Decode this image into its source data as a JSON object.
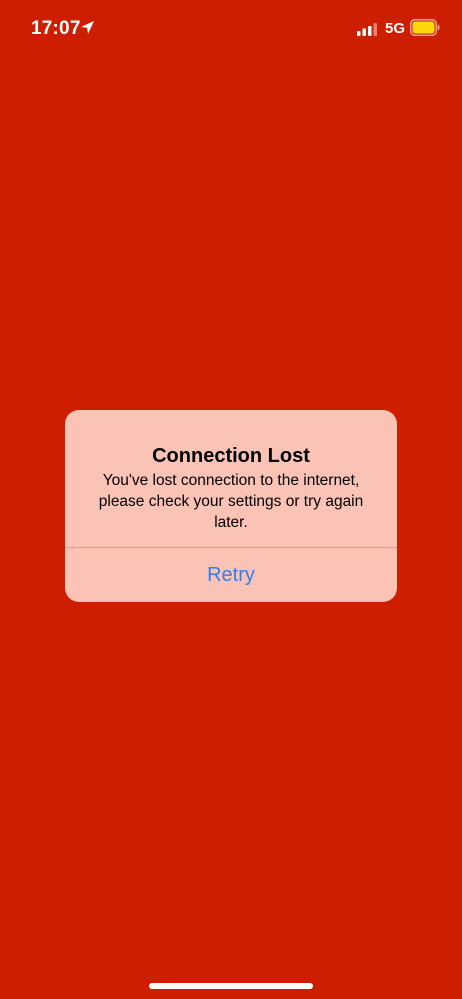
{
  "status_bar": {
    "time": "17:07",
    "network": "5G",
    "location_icon": "location-arrow-icon",
    "signal_icon": "cellular-signal-icon",
    "battery_icon": "battery-icon",
    "battery_color": "#ffd60a"
  },
  "alert": {
    "title": "Connection Lost",
    "message": "You've lost connection to the internet, please check your settings or try again later.",
    "retry_label": "Retry"
  },
  "colors": {
    "background": "#cd1f00",
    "alert_background": "#fbc3b6",
    "button_text": "#2f7ef2"
  }
}
